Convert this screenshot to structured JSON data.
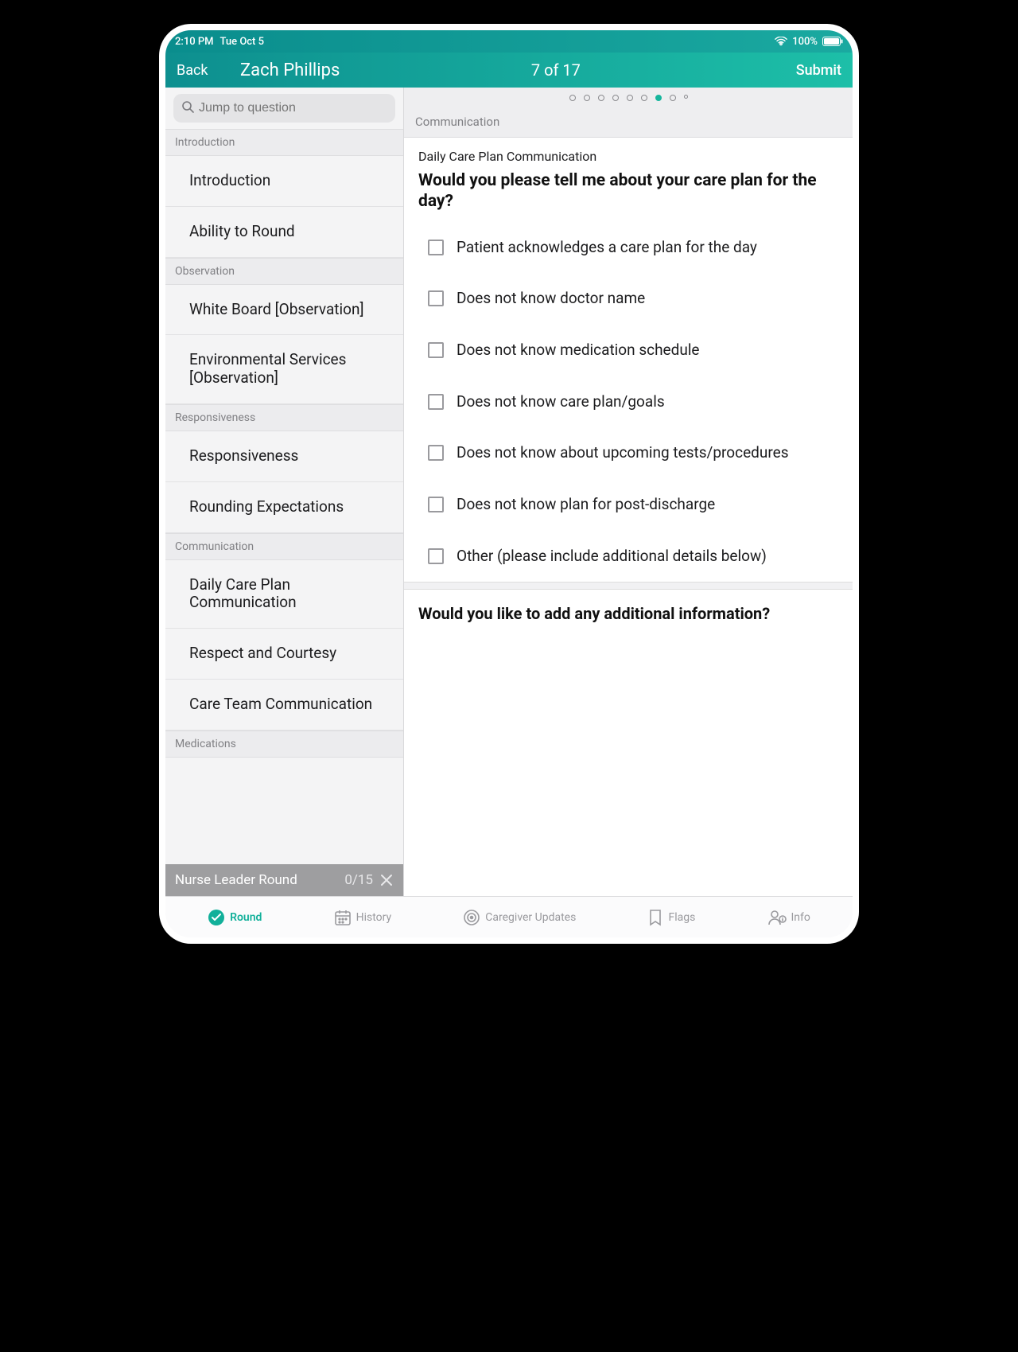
{
  "status_bar": {
    "time": "2:10 PM",
    "date": "Tue Oct 5",
    "battery": "100%"
  },
  "header": {
    "back": "Back",
    "patient_name": "Zach Phillips",
    "counter": "7 of 17",
    "submit": "Submit"
  },
  "search": {
    "placeholder": "Jump to question"
  },
  "sidebar_sections": [
    {
      "title": "Introduction",
      "items": [
        "Introduction",
        "Ability to Round"
      ]
    },
    {
      "title": "Observation",
      "items": [
        "White Board [Observation]",
        "Environmental Services [Observation]"
      ]
    },
    {
      "title": "Responsiveness",
      "items": [
        "Responsiveness",
        "Rounding Expectations"
      ]
    },
    {
      "title": "Communication",
      "items": [
        "Daily Care Plan Communication",
        "Respect and Courtesy",
        "Care Team Communication"
      ]
    },
    {
      "title": "Medications",
      "items": []
    }
  ],
  "progress": {
    "label": "Nurse Leader Round",
    "count": "0/15"
  },
  "main": {
    "section": "Communication",
    "question_title": "Daily Care Plan Communication",
    "question_prompt": "Would you please tell me about your care plan for the day?",
    "options": [
      "Patient acknowledges a care plan for the day",
      "Does not know doctor name",
      "Does not know medication schedule",
      "Does not know care plan/goals",
      "Does not know about upcoming tests/procedures",
      "Does not know plan for post-discharge",
      "Other (please include additional details below)"
    ],
    "followup": "Would you like to add any additional information?"
  },
  "tabs": {
    "round": "Round",
    "history": "History",
    "caregiver": "Caregiver Updates",
    "flags": "Flags",
    "info": "Info"
  },
  "dots_active_index": 6,
  "dots_count": 9
}
